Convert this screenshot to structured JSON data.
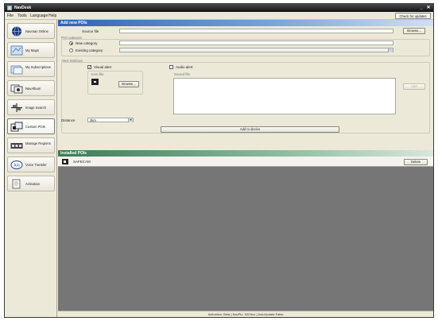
{
  "window": {
    "title": "NavDesk"
  },
  "menu": [
    "File",
    "Tools",
    "Language",
    "Help"
  ],
  "updates_button": "Check for updates",
  "sidebar": {
    "items": [
      {
        "label": "Navman Online",
        "icon": "globe-icon"
      },
      {
        "label": "My Maps",
        "icon": "map-icon"
      },
      {
        "label": "My Subscriptions",
        "icon": "subscription-icon"
      },
      {
        "label": "NavAlbum",
        "icon": "album-icon"
      },
      {
        "label": "Image Search",
        "icon": "image-search-icon"
      },
      {
        "label": "Custom POIs",
        "icon": "custom-poi-icon"
      },
      {
        "label": "Manage Regions",
        "icon": "manage-regions-icon"
      },
      {
        "label": "Voice Transfer",
        "icon": "voice-transfer-icon"
      },
      {
        "label": "Activation",
        "icon": "activation-icon"
      }
    ],
    "active": "Custom POIs"
  },
  "add_poi": {
    "header": "Add new POIs",
    "source_file_label": "Source file",
    "source_file_value": "",
    "browse_label": "Browse...",
    "poi_category_label": "POI category",
    "new_category_label": "New category",
    "new_category_value": "",
    "existing_category_label": "Existing category",
    "existing_category_value": "",
    "alert_settings_label": "Alert Settings",
    "visual_alert_label": "Visual alert",
    "visual_alert_checked": true,
    "icon_file_label": "Icon file",
    "icon_browse_label": "Browse...",
    "audio_alert_label": "Audio alert",
    "audio_alert_checked": false,
    "sound_file_label": "Sound file",
    "add_label": "Add",
    "distance_label": "Distance",
    "distance_value": "2km",
    "add_to_device_label": "Add to device"
  },
  "installed": {
    "header": "Installed POIs",
    "items": [
      {
        "name": "SAFECAM"
      }
    ],
    "delete_label": "Delete"
  },
  "status": "Activation: Beta | NavPix: SATAcc | AutoUpdate:False",
  "colors": {
    "header_blue": "#2f62b5",
    "header_green": "#3b7a55",
    "list_background": "#767676"
  }
}
